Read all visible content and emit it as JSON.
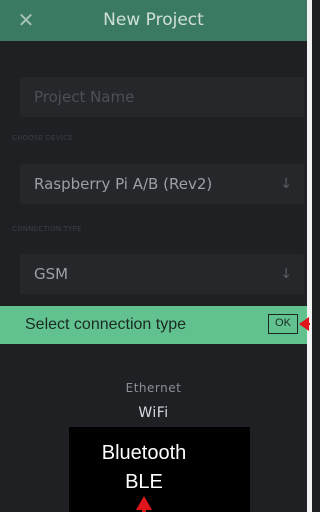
{
  "header": {
    "title": "New Project",
    "close_icon": "close-icon"
  },
  "form": {
    "project_name_placeholder": "Project Name",
    "choose_device_label": "CHOOSE DEVICE",
    "device_value": "Raspberry Pi A/B (Rev2)",
    "connection_type_label": "CONNECTION TYPE",
    "connection_value": "GSM",
    "dropdown_icon": "arrow-down-icon"
  },
  "picker": {
    "title": "Select connection type",
    "ok_label": "OK",
    "options": [
      "Ethernet",
      "WiFi"
    ]
  },
  "callout": {
    "line1": "Bluetooth",
    "line2": "BLE"
  },
  "colors": {
    "header_bg": "#3b7a62",
    "banner_bg": "#62c28f",
    "background": "#1e2024",
    "marker": "#e0151b"
  }
}
